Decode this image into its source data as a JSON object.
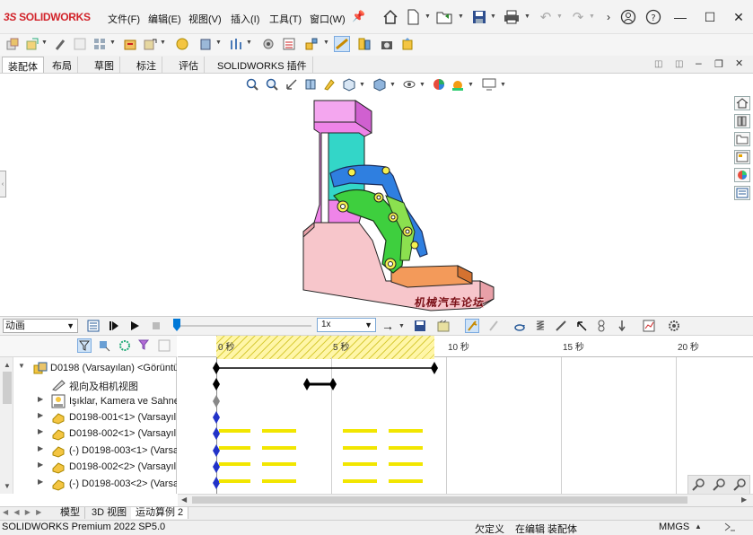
{
  "app": {
    "logo_text": "SOLIDWORKS",
    "logo_prefix": "3S"
  },
  "menu": [
    {
      "label": "文件(F)"
    },
    {
      "label": "编辑(E)"
    },
    {
      "label": "视图(V)"
    },
    {
      "label": "插入(I)"
    },
    {
      "label": "工具(T)"
    },
    {
      "label": "窗口(W)"
    }
  ],
  "tabs": [
    {
      "label": "装配体"
    },
    {
      "label": "布局"
    },
    {
      "label": "草图"
    },
    {
      "label": "标注"
    },
    {
      "label": "评估"
    },
    {
      "label": "SOLIDWORKS 插件"
    }
  ],
  "viewport": {
    "watermark": "机械汽车论坛"
  },
  "motion": {
    "study_type": "动画",
    "speed": "1x",
    "timeline_ticks": [
      "0 秒",
      "5 秒",
      "10 秒",
      "15 秒",
      "20 秒"
    ]
  },
  "tree": [
    {
      "label": "D0198 (Varsayılan) <Görüntü",
      "icon": "assembly-icon"
    },
    {
      "label": "视向及相机视图",
      "icon": "camera-icon"
    },
    {
      "label": "Işıklar, Kamera ve Sahne",
      "icon": "lights-icon"
    },
    {
      "label": "D0198-001<1> (Varsayıl",
      "icon": "part-icon"
    },
    {
      "label": "D0198-002<1> (Varsayıl",
      "icon": "part-icon"
    },
    {
      "label": "(-) D0198-003<1> (Varsa",
      "icon": "part-icon"
    },
    {
      "label": "D0198-002<2> (Varsayıl",
      "icon": "part-icon"
    },
    {
      "label": "(-) D0198-003<2> (Varsa",
      "icon": "part-icon"
    }
  ],
  "bottom_tabs": [
    {
      "label": "模型"
    },
    {
      "label": "3D 视图"
    },
    {
      "label": "运动算例 2"
    }
  ],
  "status": {
    "product": "SOLIDWORKS Premium 2022 SP5.0",
    "define": "欠定义",
    "editing": "在编辑 装配体",
    "units": "MMGS"
  },
  "colors": {
    "brand_red": "#d2232a",
    "timeline_hatch": "#fff6a8",
    "key_bar": "#f2e600",
    "accent_blue": "#0078d7"
  }
}
